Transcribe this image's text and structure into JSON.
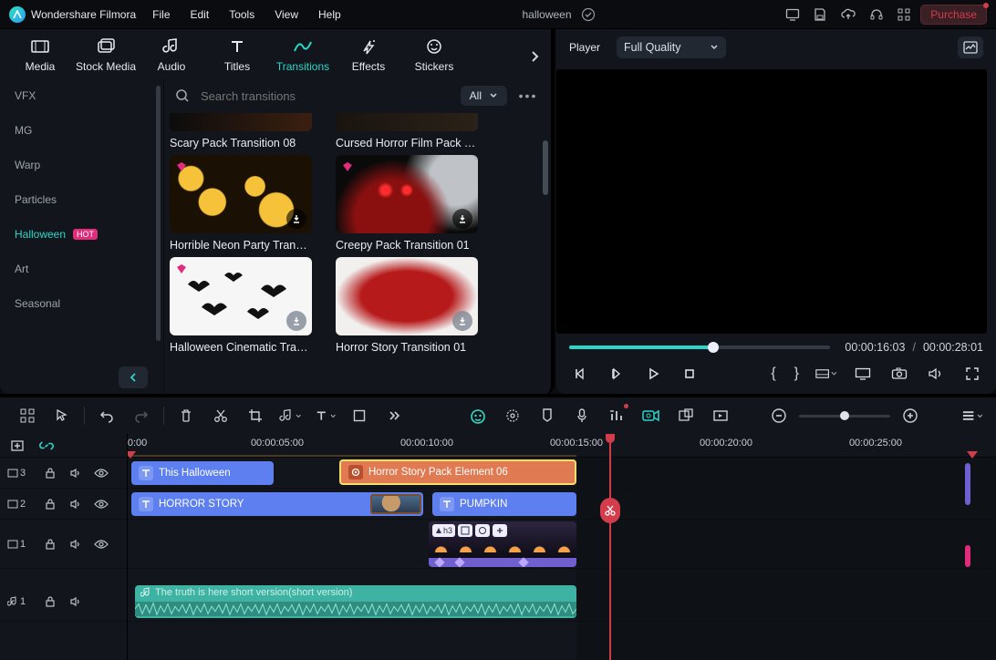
{
  "app": {
    "name": "Wondershare Filmora"
  },
  "menus": [
    "File",
    "Edit",
    "Tools",
    "View",
    "Help"
  ],
  "project_name": "halloween",
  "purchase_label": "Purchase",
  "media_tabs": [
    {
      "id": "media",
      "label": "Media"
    },
    {
      "id": "stock",
      "label": "Stock Media"
    },
    {
      "id": "audio",
      "label": "Audio"
    },
    {
      "id": "titles",
      "label": "Titles"
    },
    {
      "id": "transitions",
      "label": "Transitions"
    },
    {
      "id": "effects",
      "label": "Effects"
    },
    {
      "id": "stickers",
      "label": "Stickers"
    }
  ],
  "active_tab": "transitions",
  "side_categories": [
    {
      "id": "vfx",
      "label": "VFX"
    },
    {
      "id": "mg",
      "label": "MG"
    },
    {
      "id": "warp",
      "label": "Warp"
    },
    {
      "id": "particles",
      "label": "Particles"
    },
    {
      "id": "halloween",
      "label": "Halloween",
      "active": true,
      "hot": true
    },
    {
      "id": "art",
      "label": "Art"
    },
    {
      "id": "seasonal",
      "label": "Seasonal"
    }
  ],
  "hot_text": "HOT",
  "search": {
    "placeholder": "Search transitions"
  },
  "filter_all_label": "All",
  "transitions_row0": [
    "Scary Pack Transition 08",
    "Cursed Horror Film Pack Tra..."
  ],
  "transitions": [
    [
      {
        "label": "Horrible Neon Party Transiti...",
        "gem": true,
        "dl": true
      },
      {
        "label": "Creepy  Pack Transition 01",
        "gem": true,
        "dl": true
      }
    ],
    [
      {
        "label": "Halloween Cinematic Transit...",
        "gem": true,
        "dl": "done"
      },
      {
        "label": "Horror Story Transition 01",
        "gem": false,
        "dl": "done"
      }
    ]
  ],
  "preview": {
    "header_label": "Player",
    "quality_label": "Full Quality",
    "current_time": "00:00:16:03",
    "duration": "00:00:28:01"
  },
  "timeline": {
    "ruler": [
      ":00:00",
      "00:00:05:00",
      "00:00:10:00",
      "00:00:15:00",
      "00:00:20:00",
      "00:00:25:00"
    ],
    "tracks": {
      "t3": {
        "label": "3"
      },
      "t2": {
        "label": "2"
      },
      "t1": {
        "label": "1"
      },
      "a1": {
        "label": "1"
      }
    },
    "clips": {
      "this_halloween": "This Halloween",
      "horror_story_elem": "Horror Story Pack Element 06",
      "horror_story_title": "HORROR STORY",
      "pumpkin": "PUMPKIN",
      "media_badge_text": "h3",
      "audio_name": "The truth is here short version(short version)"
    }
  }
}
